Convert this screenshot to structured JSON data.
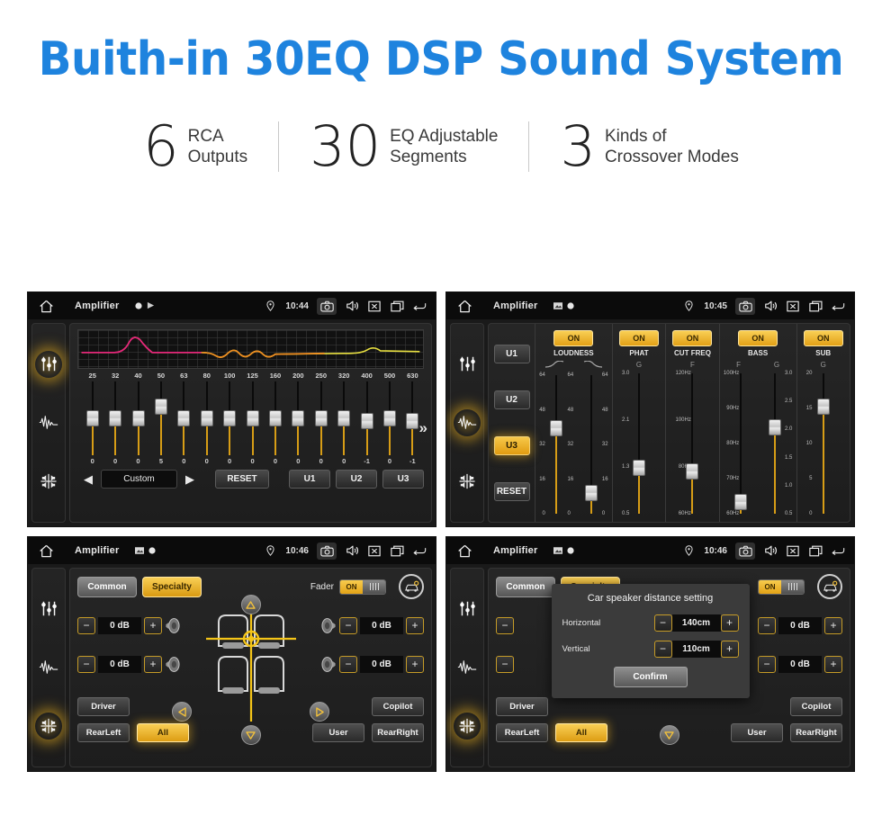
{
  "header": {
    "title": "Buith-in 30EQ DSP Sound System",
    "accent_color": "#1e83de",
    "stats": [
      {
        "number": "6",
        "line1": "RCA",
        "line2": "Outputs"
      },
      {
        "number": "30",
        "line1": "EQ Adjustable",
        "line2": "Segments"
      },
      {
        "number": "3",
        "line1": "Kinds of",
        "line2": "Crossover Modes"
      }
    ]
  },
  "panel_eq": {
    "statusbar": {
      "app": "Amplifier",
      "time": "10:44",
      "icons": [
        "home-icon",
        "record-dot-icon",
        "play-icon",
        "location-pin-icon",
        "camera-icon",
        "volume-icon",
        "close-box-icon",
        "recent-apps-icon",
        "back-arrow-icon"
      ]
    },
    "sidebar": [
      {
        "icon": "equalizer-sliders-icon",
        "active": true
      },
      {
        "icon": "waveform-icon",
        "active": false
      },
      {
        "icon": "balance-arrows-icon",
        "active": false
      }
    ],
    "freq_labels": [
      "25",
      "32",
      "40",
      "50",
      "63",
      "80",
      "100",
      "125",
      "160",
      "200",
      "250",
      "320",
      "400",
      "500",
      "630"
    ],
    "band_values": [
      "0",
      "0",
      "0",
      "5",
      "0",
      "0",
      "0",
      "0",
      "0",
      "0",
      "0",
      "0",
      "-1",
      "0",
      "-1"
    ],
    "more_chevron": "»",
    "controls": {
      "prev": "◀",
      "preset": "Custom",
      "next": "▶",
      "reset": "RESET",
      "u1": "U1",
      "u2": "U2",
      "u3": "U3"
    }
  },
  "panel_dsp": {
    "statusbar": {
      "app": "Amplifier",
      "time": "10:45"
    },
    "sidebar": [
      {
        "icon": "equalizer-sliders-icon",
        "active": false
      },
      {
        "icon": "waveform-icon",
        "active": true
      },
      {
        "icon": "balance-arrows-icon",
        "active": false
      }
    ],
    "presets": [
      {
        "label": "U1",
        "active": false
      },
      {
        "label": "U2",
        "active": false
      },
      {
        "label": "U3",
        "active": true
      }
    ],
    "reset": "RESET",
    "sections": [
      {
        "name": "LOUDNESS",
        "on": "ON",
        "headers": [
          "curve-low-icon",
          "curve-high-icon"
        ],
        "sliders": [
          {
            "scale_left": [
              "64",
              "48",
              "32",
              "16",
              "0"
            ],
            "scale_right": [
              "64",
              "48",
              "32",
              "16",
              "0"
            ],
            "value_pct": 58
          },
          {
            "scale_left": [],
            "scale_right": [
              "64",
              "48",
              "32",
              "16",
              "0"
            ],
            "value_pct": 13
          }
        ]
      },
      {
        "name": "PHAT",
        "on": "ON",
        "headers": [
          "G"
        ],
        "sliders": [
          {
            "scale_left": [
              "3.0",
              "2.1",
              "1.3",
              "0.5"
            ],
            "scale_right": [],
            "value_pct": 30
          }
        ]
      },
      {
        "name": "CUT FREQ",
        "on": "ON",
        "headers": [
          "F"
        ],
        "sliders": [
          {
            "scale_left": [
              "120Hz",
              "100Hz",
              "80Hz",
              "60Hz"
            ],
            "scale_right": [],
            "value_pct": 28
          }
        ]
      },
      {
        "name": "BASS",
        "on": "ON",
        "headers": [
          "F",
          "G"
        ],
        "sliders": [
          {
            "scale_left": [
              "100Hz",
              "90Hz",
              "80Hz",
              "70Hz",
              "60Hz"
            ],
            "scale_right": [],
            "value_pct": 7
          },
          {
            "scale_left": [],
            "scale_right": [
              "3.0",
              "2.5",
              "2.0",
              "1.5",
              "1.0",
              "0.5"
            ],
            "value_pct": 58
          }
        ]
      },
      {
        "name": "SUB",
        "on": "ON",
        "headers": [
          "G"
        ],
        "sliders": [
          {
            "scale_left": [
              "20",
              "15",
              "10",
              "5",
              "0"
            ],
            "scale_right": [],
            "value_pct": 72
          }
        ]
      }
    ]
  },
  "panel_fader": {
    "statusbar": {
      "app": "Amplifier",
      "time": "10:46"
    },
    "sidebar": [
      {
        "icon": "equalizer-sliders-icon",
        "active": false
      },
      {
        "icon": "waveform-icon",
        "active": false
      },
      {
        "icon": "balance-arrows-icon",
        "active": true
      }
    ],
    "tabs": [
      {
        "label": "Common",
        "active": false
      },
      {
        "label": "Specialty",
        "active": true
      }
    ],
    "fader_label": "Fader",
    "fader_toggle": "ON",
    "car_config_icon": "car-settings-icon",
    "steppers": [
      {
        "position": "front-left",
        "minus": "−",
        "value": "0 dB",
        "plus": "+",
        "speaker": "speaker-icon"
      },
      {
        "position": "rear-left",
        "minus": "−",
        "value": "0 dB",
        "plus": "+",
        "speaker": "speaker-icon"
      },
      {
        "position": "front-right",
        "minus": "−",
        "value": "0 dB",
        "plus": "+",
        "speaker": "speaker-icon"
      },
      {
        "position": "rear-right",
        "minus": "−",
        "value": "0 dB",
        "plus": "+",
        "speaker": "speaker-icon"
      }
    ],
    "nav_icons": [
      "nav-up-icon",
      "nav-down-icon",
      "nav-left-icon",
      "nav-right-icon"
    ],
    "seat_diagram_icon": "car-seats-diagram",
    "position_buttons": [
      {
        "label": "Driver",
        "active": false
      },
      {
        "label": "RearLeft",
        "active": false
      },
      {
        "label": "All",
        "active": true
      },
      {
        "label": "User",
        "active": false
      },
      {
        "label": "Copilot",
        "active": false
      },
      {
        "label": "RearRight",
        "active": false
      }
    ]
  },
  "panel_dialog": {
    "statusbar": {
      "app": "Amplifier",
      "time": "10:46"
    },
    "sidebar": [
      {
        "icon": "equalizer-sliders-icon",
        "active": false
      },
      {
        "icon": "waveform-icon",
        "active": false
      },
      {
        "icon": "balance-arrows-icon",
        "active": true
      }
    ],
    "tabs": [
      {
        "label": "Common",
        "active": false
      },
      {
        "label": "Specialty",
        "active": true
      }
    ],
    "fader_toggle": "ON",
    "position_buttons": [
      {
        "label": "Driver",
        "active": false
      },
      {
        "label": "RearLeft",
        "active": false
      },
      {
        "label": "All",
        "active": true
      },
      {
        "label": "User",
        "active": false
      },
      {
        "label": "Copilot",
        "active": false
      },
      {
        "label": "RearRight",
        "active": false
      }
    ],
    "steppers": [
      {
        "value": "0 dB"
      },
      {
        "value": "0 dB"
      }
    ],
    "dialog": {
      "title": "Car speaker distance setting",
      "rows": [
        {
          "label": "Horizontal",
          "minus": "−",
          "value": "140cm",
          "plus": "+"
        },
        {
          "label": "Vertical",
          "minus": "−",
          "value": "110cm",
          "plus": "+"
        }
      ],
      "confirm": "Confirm"
    }
  }
}
